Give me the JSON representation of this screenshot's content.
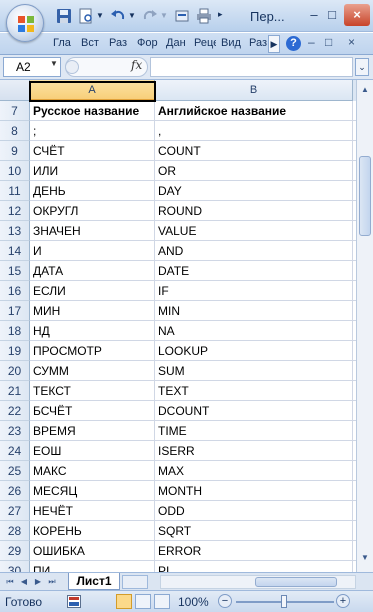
{
  "window": {
    "title": "Пер...",
    "minimize": "–",
    "maximize": "□",
    "close": "×"
  },
  "ribbon": {
    "tabs": [
      "Гла",
      "Вст",
      "Раз",
      "Фор",
      "Дан",
      "Реце",
      "Вид",
      "Раз"
    ],
    "minimize": "–",
    "restore": "□",
    "close": "×",
    "help": "?"
  },
  "formula_bar": {
    "name_box": "A2",
    "fx": "fx",
    "formula": ""
  },
  "grid": {
    "columns": [
      "A",
      "B"
    ],
    "rows": [
      {
        "num": "7",
        "a": "Русское название",
        "b": "Английское название",
        "bold": true
      },
      {
        "num": "8",
        "a": ";",
        "b": ","
      },
      {
        "num": "9",
        "a": "СЧЁТ",
        "b": "COUNT"
      },
      {
        "num": "10",
        "a": "ИЛИ",
        "b": "OR"
      },
      {
        "num": "11",
        "a": "ДЕНЬ",
        "b": "DAY"
      },
      {
        "num": "12",
        "a": "ОКРУГЛ",
        "b": "ROUND"
      },
      {
        "num": "13",
        "a": "ЗНАЧЕН",
        "b": "VALUE"
      },
      {
        "num": "14",
        "a": "И",
        "b": "AND"
      },
      {
        "num": "15",
        "a": "ДАТА",
        "b": "DATE"
      },
      {
        "num": "16",
        "a": "ЕСЛИ",
        "b": "IF"
      },
      {
        "num": "17",
        "a": "МИН",
        "b": "MIN"
      },
      {
        "num": "18",
        "a": "НД",
        "b": "NA"
      },
      {
        "num": "19",
        "a": "ПРОСМОТР",
        "b": "LOOKUP"
      },
      {
        "num": "20",
        "a": "СУММ",
        "b": "SUM"
      },
      {
        "num": "21",
        "a": "ТЕКСТ",
        "b": "TEXT"
      },
      {
        "num": "22",
        "a": "БСЧЁТ",
        "b": "DCOUNT"
      },
      {
        "num": "23",
        "a": "ВРЕМЯ",
        "b": "TIME"
      },
      {
        "num": "24",
        "a": "ЕОШ",
        "b": "ISERR"
      },
      {
        "num": "25",
        "a": "МАКС",
        "b": "MAX"
      },
      {
        "num": "26",
        "a": "МЕСЯЦ",
        "b": "MONTH"
      },
      {
        "num": "27",
        "a": "НЕЧЁТ",
        "b": "ODD"
      },
      {
        "num": "28",
        "a": "КОРЕНЬ",
        "b": "SQRT"
      },
      {
        "num": "29",
        "a": "ОШИБКА",
        "b": "ERROR"
      },
      {
        "num": "30",
        "a": "ПИ",
        "b": "PI"
      }
    ]
  },
  "sheet_tabs": {
    "active": "Лист1"
  },
  "status_bar": {
    "status": "Готово",
    "zoom": "100%",
    "zoom_out": "−",
    "zoom_in": "+"
  },
  "colors": {
    "ribbon": "#bfd4ee",
    "header_selected": "#f8cf7a",
    "gridline": "#d0d7e5"
  }
}
